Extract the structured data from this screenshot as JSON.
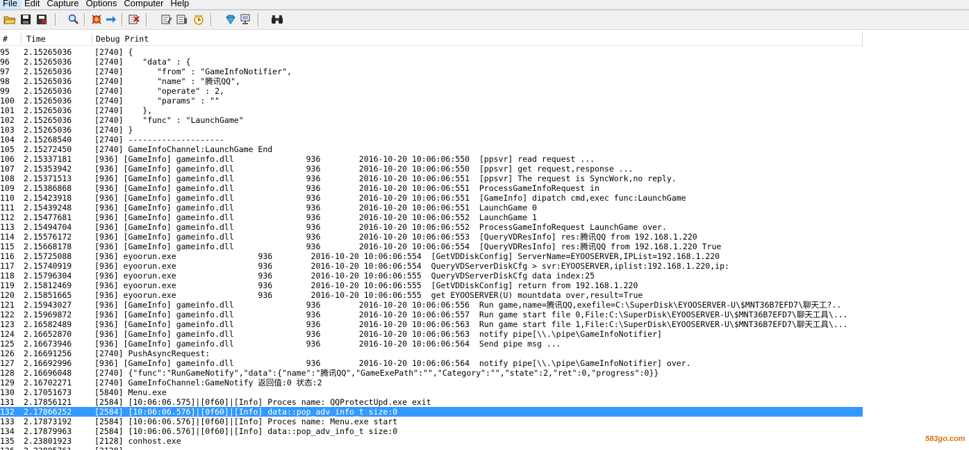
{
  "menu": [
    "File",
    "Edit",
    "Capture",
    "Options",
    "Computer",
    "Help"
  ],
  "toolbar": [
    {
      "icon": "open-folder-icon",
      "color": "#d9a520"
    },
    {
      "icon": "save-icon",
      "color": "#1a1a1a"
    },
    {
      "icon": "log-boot-icon",
      "color": "#c02020"
    },
    {
      "icon": "find-icon",
      "color": "#2060c0"
    },
    {
      "icon": "capture-win32-icon",
      "color": "#e03010"
    },
    {
      "icon": "autoscroll-arrow-icon",
      "color": "#1e7fd6"
    },
    {
      "icon": "clear-display-icon",
      "color": "#c02020"
    },
    {
      "icon": "edit-filter-icon",
      "color": "#333333"
    },
    {
      "icon": "highlight-icon",
      "color": "#333333"
    },
    {
      "icon": "clock-icon",
      "color": "#e0a000"
    },
    {
      "icon": "diamond-icon",
      "color": "#1890d0"
    },
    {
      "icon": "computer-icon",
      "color": "#444444"
    },
    {
      "icon": "binoculars-icon",
      "color": "#222222"
    }
  ],
  "columns": {
    "num": "#",
    "time": "Time",
    "debug": "Debug Print"
  },
  "selected_index": 37,
  "rows": [
    [
      "95",
      "2.15265036",
      "[2740] {"
    ],
    [
      "96",
      "2.15265036",
      "[2740]    \"data\" : {"
    ],
    [
      "97",
      "2.15265036",
      "[2740]       \"from\" : \"GameInfoNotifier\","
    ],
    [
      "98",
      "2.15265036",
      "[2740]       \"name\" : \"腾讯QQ\","
    ],
    [
      "99",
      "2.15265036",
      "[2740]       \"operate\" : 2,"
    ],
    [
      "100",
      "2.15265036",
      "[2740]       \"params\" : \"\""
    ],
    [
      "101",
      "2.15265036",
      "[2740]    },"
    ],
    [
      "102",
      "2.15265036",
      "[2740]    \"func\" : \"LaunchGame\""
    ],
    [
      "103",
      "2.15265036",
      "[2740] }"
    ],
    [
      "104",
      "2.15268540",
      "[2740] --------------------"
    ],
    [
      "105",
      "2.15272450",
      "[2740] GameInfoChannel:LaunchGame End"
    ],
    [
      "106",
      "2.15337181",
      "[936] [GameInfo] gameinfo.dll               936        2016-10-20 10:06:06:550  [ppsvr] read request ..."
    ],
    [
      "107",
      "2.15353942",
      "[936] [GameInfo] gameinfo.dll               936        2016-10-20 10:06:06:550  [ppsvr] get request,response ..."
    ],
    [
      "108",
      "2.15371513",
      "[936] [GameInfo] gameinfo.dll               936        2016-10-20 10:06:06:551  [ppsvr] The request is SyncWork,no reply."
    ],
    [
      "109",
      "2.15386868",
      "[936] [GameInfo] gameinfo.dll               936        2016-10-20 10:06:06:551  ProcessGameInfoRequest in"
    ],
    [
      "110",
      "2.15423918",
      "[936] [GameInfo] gameinfo.dll               936        2016-10-20 10:06:06:551  [GameInfo] dipatch cmd,exec func:LaunchGame"
    ],
    [
      "111",
      "2.15439248",
      "[936] [GameInfo] gameinfo.dll               936        2016-10-20 10:06:06:551  LaunchGame 0"
    ],
    [
      "112",
      "2.15477681",
      "[936] [GameInfo] gameinfo.dll               936        2016-10-20 10:06:06:552  LaunchGame 1"
    ],
    [
      "113",
      "2.15494704",
      "[936] [GameInfo] gameinfo.dll               936        2016-10-20 10:06:06:552  ProcessGameInfoRequest LaunchGame over."
    ],
    [
      "114",
      "2.15576172",
      "[936] [GameInfo] gameinfo.dll               936        2016-10-20 10:06:06:553  [QueryVDResInfo] res:腾讯QQ from 192.168.1.220"
    ],
    [
      "115",
      "2.15668178",
      "[936] [GameInfo] gameinfo.dll               936        2016-10-20 10:06:06:554  [QueryVDResInfo] res:腾讯QQ from 192.168.1.220 True"
    ],
    [
      "116",
      "2.15725088",
      "[936] eyoorun.exe                 936        2016-10-20 10:06:06:554  [GetVDDiskConfig] ServerName=EYOOSERVER,IPList=192.168.1.220"
    ],
    [
      "117",
      "2.15740919",
      "[936] eyoorun.exe                 936        2016-10-20 10:06:06:554  QueryVDServerDiskCfg > svr:EYOOSERVER,iplist:192.168.1.220,ip:"
    ],
    [
      "118",
      "2.15796304",
      "[936] eyoorun.exe                 936        2016-10-20 10:06:06:555  QueryVDServerDiskCfg data index:25"
    ],
    [
      "119",
      "2.15812469",
      "[936] eyoorun.exe                 936        2016-10-20 10:06:06:555  [GetVDDiskConfig] return from 192.168.1.220"
    ],
    [
      "120",
      "2.15851665",
      "[936] eyoorun.exe                 936        2016-10-20 10:06:06:555  get EYOOSERVER(U) mountdata over,result=True"
    ],
    [
      "121",
      "2.15943027",
      "[936] [GameInfo] gameinfo.dll               936        2016-10-20 10:06:06:556  Run game,name=腾讯QQ,exefile=C:\\SuperDisk\\EYOOSERVER-U\\$MNT36B7EFD7\\聊天工?.."
    ],
    [
      "122",
      "2.15969872",
      "[936] [GameInfo] gameinfo.dll               936        2016-10-20 10:06:06:557  Run game start file 0,File:C:\\SuperDisk\\EYOOSERVER-U\\$MNT36B7EFD7\\聊天工具\\..."
    ],
    [
      "123",
      "2.16582489",
      "[936] [GameInfo] gameinfo.dll               936        2016-10-20 10:06:06:563  Run game start file 1,File:C:\\SuperDisk\\EYOOSERVER-U\\$MNT36B7EFD7\\聊天工具\\..."
    ],
    [
      "124",
      "2.16652870",
      "[936] [GameInfo] gameinfo.dll               936        2016-10-20 10:06:06:563  notify pipe[\\\\.\\pipe\\GameInfoNotifier]"
    ],
    [
      "125",
      "2.16673946",
      "[936] [GameInfo] gameinfo.dll               936        2016-10-20 10:06:06:564  Send pipe msg ..."
    ],
    [
      "126",
      "2.16691256",
      "[2740] PushAsyncRequest:"
    ],
    [
      "127",
      "2.16692996",
      "[936] [GameInfo] gameinfo.dll               936        2016-10-20 10:06:06:564  notify pipe[\\\\.\\pipe\\GameInfoNotifier] over."
    ],
    [
      "128",
      "2.16696048",
      "[2740] {\"func\":\"RunGameNotify\",\"data\":{\"name\":\"腾讯QQ\",\"GameExePath\":\"\",\"Category\":\"\",\"state\":2,\"ret\":0,\"progress\":0}}"
    ],
    [
      "129",
      "2.16702271",
      "[2740] GameInfoChannel:GameNotify 返回值:0 状态:2"
    ],
    [
      "130",
      "2.17051673",
      "[5840] Menu.exe"
    ],
    [
      "131",
      "2.17856121",
      "[2584] [10:06:06.575]|[0f60]|[Info] Proces name: QQProtectUpd.exe exit"
    ],
    [
      "132",
      "2.17866252",
      "[2584] [10:06:06.576]|[0f60]|[Info] data::pop_adv_info_t size:0"
    ],
    [
      "133",
      "2.17873192",
      "[2584] [10:06:06.576]|[0f60]|[Info] Proces name: Menu.exe start"
    ],
    [
      "134",
      "2.17879963",
      "[2584] [10:06:06.576]|[0f60]|[Info] data::pop_adv_info_t size:0"
    ],
    [
      "135",
      "2.23801923",
      "[2128] conhost.exe"
    ],
    [
      "136",
      "2.23805761",
      "[2128] ..."
    ]
  ],
  "watermark": "583go.com",
  "selection_color": "#3399ff"
}
